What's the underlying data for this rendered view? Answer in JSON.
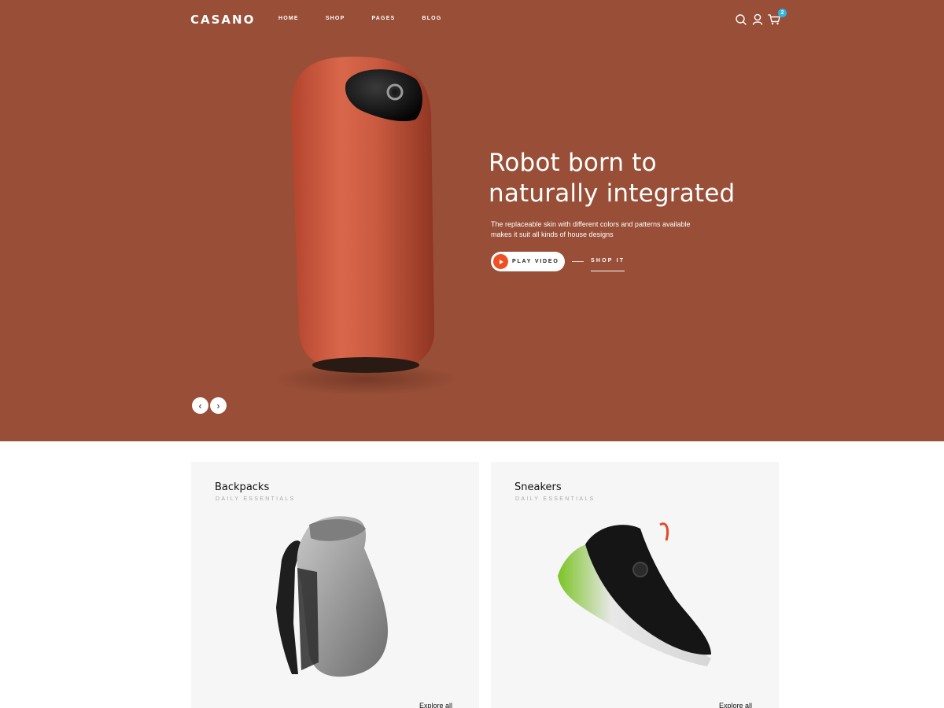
{
  "brand": {
    "logo": "CASANO"
  },
  "nav": {
    "items": [
      "HOME",
      "SHOP",
      "PAGES",
      "BLOG"
    ]
  },
  "header": {
    "icons": [
      "search-icon",
      "user-icon",
      "cart-icon"
    ],
    "cart_count": "2",
    "badge_color": "#29b6e8"
  },
  "hero": {
    "background_color": "#984e37",
    "title_lines": [
      "Robot born to",
      "naturally integrated"
    ],
    "description_lines": [
      "The replaceable skin with different colors and patterns available",
      "makes it suit all kinds of house designs"
    ],
    "play_button": {
      "label": "PLAY VIDEO",
      "accent_color": "#f04e23"
    },
    "shop_link": "SHOP IT",
    "prev_arrow": "‹",
    "next_arrow": "›"
  },
  "cards": [
    {
      "title": "Backpacks",
      "subtitle": "DAILY ESSENTIALS",
      "link": "Explore all"
    },
    {
      "title": "Sneakers",
      "subtitle": "DAILY ESSENTIALS",
      "link": "Explore all"
    }
  ]
}
